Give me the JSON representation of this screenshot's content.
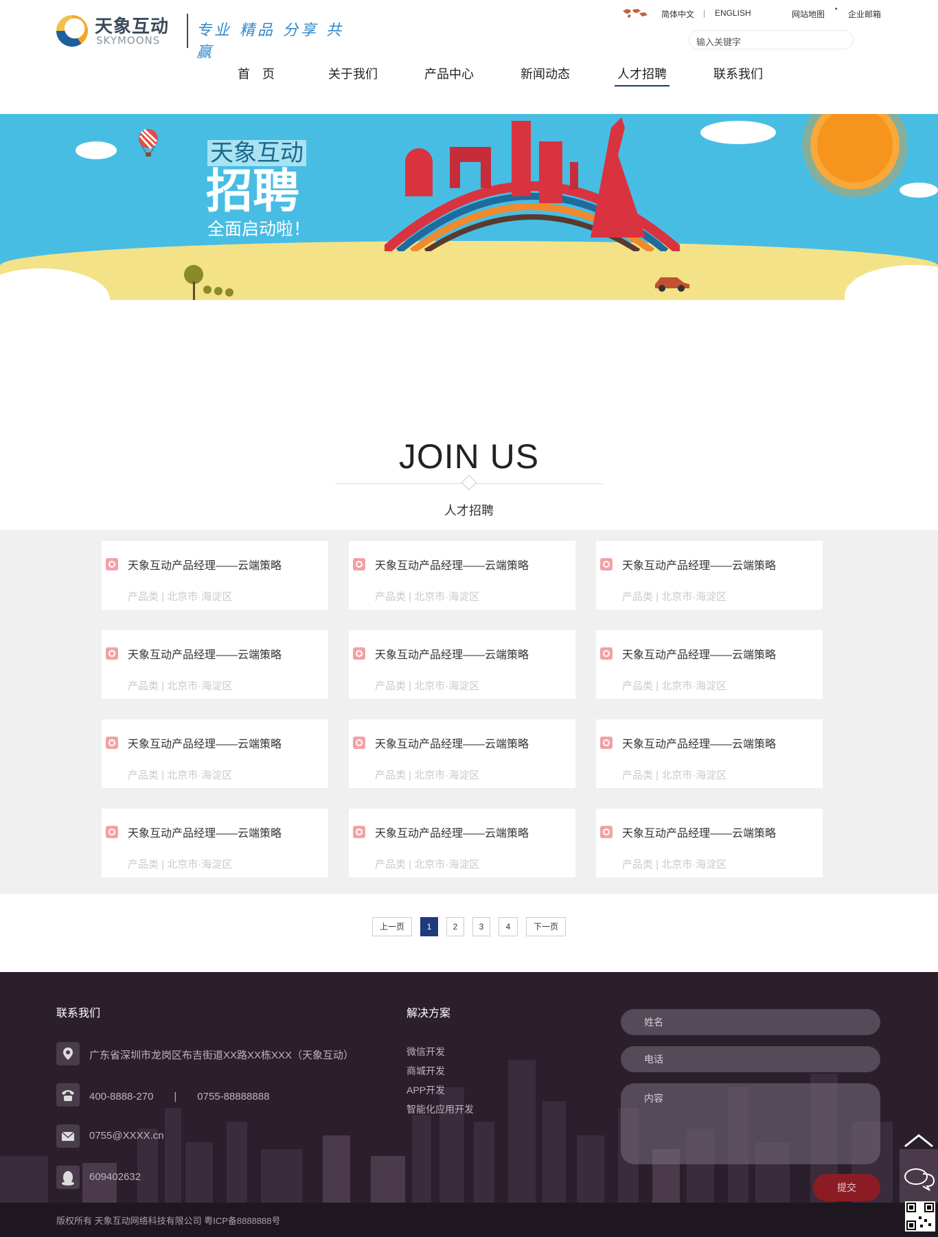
{
  "header": {
    "logo_cn": "天象互动",
    "logo_en": "SKYMOONS",
    "slogan": "专业 精品 分享 共赢",
    "lang_cn": "简体中文",
    "lang_sep": "|",
    "lang_en": "ENGLISH",
    "sitemap": "网站地图",
    "mail": "企业邮箱",
    "search_placeholder": "输入关键字",
    "nav": [
      "首　页",
      "关于我们",
      "产品中心",
      "新闻动态",
      "人才招聘",
      "联系我们"
    ],
    "active_nav": "人才招聘"
  },
  "banner": {
    "tag": "天象互动",
    "big": "招聘",
    "sub": "全面启动啦！"
  },
  "join": {
    "title": "JOIN US",
    "subtitle": "人才招聘"
  },
  "jobs": [
    {
      "title": "天象互动产品经理——云端策略",
      "meta": "产品类 | 北京市·海淀区"
    },
    {
      "title": "天象互动产品经理——云端策略",
      "meta": "产品类 | 北京市·海淀区"
    },
    {
      "title": "天象互动产品经理——云端策略",
      "meta": "产品类 | 北京市·海淀区"
    },
    {
      "title": "天象互动产品经理——云端策略",
      "meta": "产品类 | 北京市·海淀区"
    },
    {
      "title": "天象互动产品经理——云端策略",
      "meta": "产品类 | 北京市·海淀区"
    },
    {
      "title": "天象互动产品经理——云端策略",
      "meta": "产品类 | 北京市·海淀区"
    },
    {
      "title": "天象互动产品经理——云端策略",
      "meta": "产品类 | 北京市·海淀区"
    },
    {
      "title": "天象互动产品经理——云端策略",
      "meta": "产品类 | 北京市·海淀区"
    },
    {
      "title": "天象互动产品经理——云端策略",
      "meta": "产品类 | 北京市·海淀区"
    },
    {
      "title": "天象互动产品经理——云端策略",
      "meta": "产品类 | 北京市·海淀区"
    },
    {
      "title": "天象互动产品经理——云端策略",
      "meta": "产品类 | 北京市·海淀区"
    },
    {
      "title": "天象互动产品经理——云端策略",
      "meta": "产品类 | 北京市·海淀区"
    }
  ],
  "pagination": {
    "prev": "上一页",
    "pages": [
      "1",
      "2",
      "3",
      "4"
    ],
    "current": "1",
    "next": "下一页"
  },
  "footer": {
    "contact_heading": "联系我们",
    "address": "广东省深圳市龙岗区布吉街道XX路XX栋XXX（天象互动）",
    "phone": "400-8888-270　　|　　0755-88888888",
    "email": "0755@XXXX.cn",
    "qq": "609402632",
    "solutions_heading": "解决方案",
    "solutions": [
      "微信开发",
      "商城开发",
      "APP开发",
      "智能化应用开发"
    ],
    "form": {
      "name_placeholder": "姓名",
      "phone_placeholder": "电话",
      "content_placeholder": "内容",
      "submit": "提交"
    },
    "copyright": "版权所有 天象互动网络科技有限公司 粤ICP备8888888号"
  },
  "colors": {
    "nav_active": "#1b3a6b",
    "banner_sky": "#48bde4",
    "page_active": "#1f3a7d",
    "submit": "#8c1c24",
    "footer_bg": "#2b1f2c"
  }
}
